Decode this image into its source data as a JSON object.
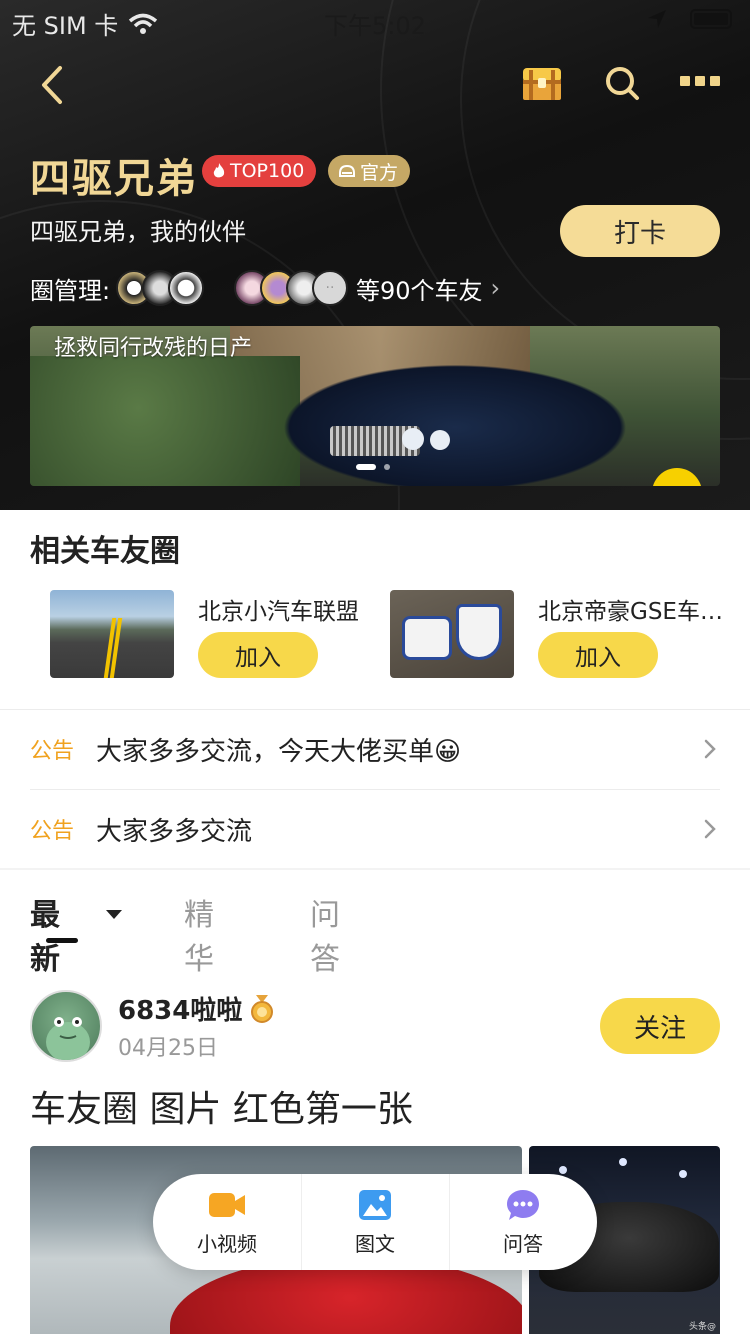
{
  "status_bar": {
    "carrier": "无 SIM 卡",
    "time": "下午5:02"
  },
  "header": {
    "title": "四驱兄弟",
    "badge_top": "TOP100",
    "badge_official": "官方",
    "description": "四驱兄弟，我的伙伴",
    "checkin_label": "打卡",
    "admin_label": "圈管理:",
    "members_label": "等90个车友",
    "banner_caption": "拯救同行改残的日产"
  },
  "related": {
    "title": "相关车友圈",
    "items": [
      {
        "name": "北京小汽车联盟",
        "join": "加入"
      },
      {
        "name": "北京帝豪GSE车友会",
        "join": "加入"
      }
    ]
  },
  "notices": [
    {
      "tag": "公告",
      "text": "大家多多交流，今天大佬买单😀"
    },
    {
      "tag": "公告",
      "text": "大家多多交流"
    }
  ],
  "tabs": [
    {
      "label": "最新"
    },
    {
      "label": "精华"
    },
    {
      "label": "问答"
    }
  ],
  "post": {
    "user": "6834啦啦",
    "date": "04月25日",
    "follow_label": "关注",
    "title": "车友圈 图片 红色第一张",
    "watermark": "头条@"
  },
  "fab": [
    {
      "label": "小视频",
      "icon": "video-icon"
    },
    {
      "label": "图文",
      "icon": "image-icon"
    },
    {
      "label": "问答",
      "icon": "chat-bubble-icon"
    }
  ],
  "colors": {
    "gold": "#f1d796",
    "accent_yellow": "#f7d84a",
    "top_badge": "#e4403e",
    "official_badge": "#c5a865",
    "notice_tag": "#f0a21f"
  }
}
